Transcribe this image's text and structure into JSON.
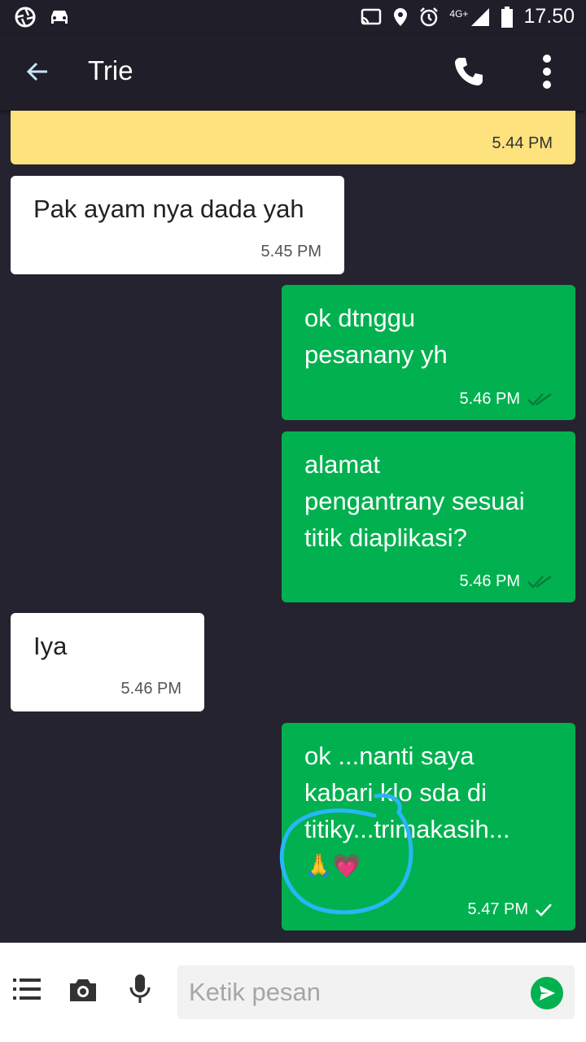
{
  "status_bar": {
    "time": "17.50",
    "network": "4G+",
    "icons": [
      "aperture-icon",
      "car-icon",
      "cast-icon",
      "location-icon",
      "alarm-icon",
      "signal-icon",
      "battery-icon"
    ]
  },
  "header": {
    "title": "Trie",
    "icons": [
      "back-arrow-icon",
      "phone-icon",
      "more-vert-icon"
    ]
  },
  "messages": [
    {
      "side": "incoming",
      "style": "yellow",
      "text": "",
      "time": "5.44 PM"
    },
    {
      "side": "incoming",
      "style": "white",
      "text": "Pak ayam nya dada yah",
      "time": "5.45 PM"
    },
    {
      "side": "outgoing",
      "style": "green",
      "line1": "ok dtnggu",
      "line2": "pesanany yh",
      "time": "5.46 PM",
      "status": "read"
    },
    {
      "side": "outgoing",
      "style": "green",
      "line1": "alamat",
      "line2": "pengantrany sesuai",
      "line3": "titik diaplikasi?",
      "time": "5.46 PM",
      "status": "read"
    },
    {
      "side": "incoming",
      "style": "white",
      "text": "Iya",
      "time": "5.46 PM"
    },
    {
      "side": "outgoing",
      "style": "green",
      "line1": "ok ...nanti saya",
      "line2": "kabari klo sda di",
      "line3": "titiky...trimakasih...",
      "emoji": "🙏💗",
      "time": "5.47 PM",
      "status": "sent"
    }
  ],
  "composer": {
    "placeholder": "Ketik pesan",
    "icons": [
      "menu-list-icon",
      "camera-icon",
      "microphone-icon",
      "send-icon"
    ]
  },
  "colors": {
    "background": "#24232f",
    "header": "#1f1e29",
    "outgoing_bubble": "#01b14f",
    "incoming_bubble": "#ffffff",
    "highlight_bubble": "#fde27d",
    "annotation_circle": "#29b6f6"
  }
}
